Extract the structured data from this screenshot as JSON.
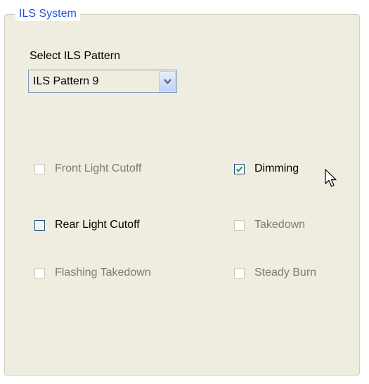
{
  "group": {
    "title": "ILS System"
  },
  "pattern": {
    "label": "Select ILS Pattern",
    "selected": "ILS Pattern 9"
  },
  "options": {
    "front_light_cutoff": {
      "label": "Front Light Cutoff",
      "checked": false,
      "enabled": false
    },
    "dimming": {
      "label": "Dimming",
      "checked": true,
      "enabled": true
    },
    "rear_light_cutoff": {
      "label": "Rear Light Cutoff",
      "checked": false,
      "enabled": true
    },
    "takedown": {
      "label": "Takedown",
      "checked": false,
      "enabled": false
    },
    "flashing_takedown": {
      "label": "Flashing Takedown",
      "checked": false,
      "enabled": false
    },
    "steady_burn": {
      "label": "Steady Burn",
      "checked": false,
      "enabled": false
    }
  },
  "colors": {
    "legend": "#1c56d6",
    "panel_bg": "#efede0",
    "checkmark": "#21a121",
    "disabled_text": "#7e7d68"
  }
}
